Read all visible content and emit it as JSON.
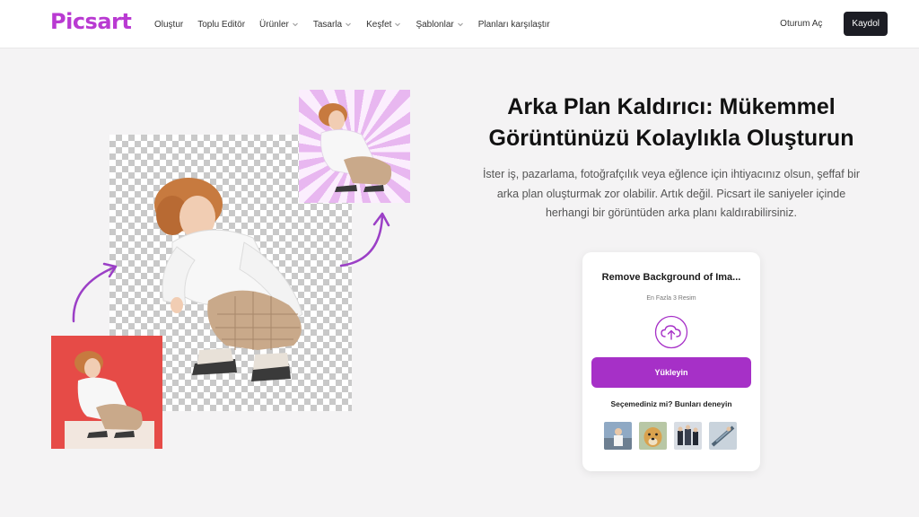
{
  "brand": {
    "logo_text": "Picsart",
    "accent_color": "#a630c7",
    "logo_color": "#b93ad2"
  },
  "nav": {
    "items": [
      {
        "label": "Oluştur",
        "has_dropdown": false
      },
      {
        "label": "Toplu Editör",
        "has_dropdown": false
      },
      {
        "label": "Ürünler",
        "has_dropdown": true
      },
      {
        "label": "Tasarla",
        "has_dropdown": true
      },
      {
        "label": "Keşfet",
        "has_dropdown": true
      },
      {
        "label": "Şablonlar",
        "has_dropdown": true
      },
      {
        "label": "Planları karşılaştır",
        "has_dropdown": false
      }
    ],
    "login_label": "Oturum Aç",
    "signup_label": "Kaydol"
  },
  "hero": {
    "title_line1": "Arka Plan Kaldırıcı: Mükemmel",
    "title_line2": "Görüntünüzü Kolaylıkla Oluşturun",
    "desc_line1": "İster iş, pazarlama, fotoğrafçılık veya eğlence için ihtiyacınız olsun, şeffaf bir",
    "desc_line2": "arka plan oluşturmak zor olabilir. Artık değil. Picsart ile saniyeler içinde",
    "desc_line3": "herhangi bir görüntüden arka planı kaldırabilirsiniz."
  },
  "upload_card": {
    "title": "Remove Background of Ima...",
    "subtitle": "En Fazla 3 Resim",
    "upload_icon": "cloud-upload-icon",
    "upload_button_label": "Yükleyin",
    "try_label": "Seçemediniz mi? Bunları deneyin",
    "samples": [
      {
        "name": "sample-image-person-blue"
      },
      {
        "name": "sample-image-dog"
      },
      {
        "name": "sample-image-group"
      },
      {
        "name": "sample-image-skateboard"
      }
    ]
  },
  "collage": {
    "left_thumb_bg": "#e64b47",
    "right_thumb_pattern": "purple-sunburst",
    "center_bg": "transparent-checkerboard"
  }
}
